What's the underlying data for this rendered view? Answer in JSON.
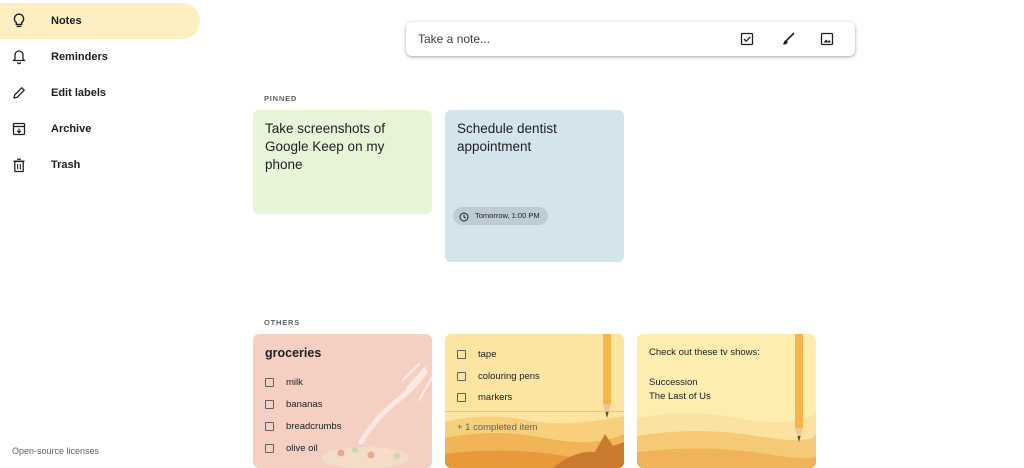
{
  "sidebar": {
    "items": [
      {
        "label": "Notes",
        "icon": "lightbulb-icon",
        "active": true
      },
      {
        "label": "Reminders",
        "icon": "bell-icon",
        "active": false
      },
      {
        "label": "Edit labels",
        "icon": "pencil-icon",
        "active": false
      },
      {
        "label": "Archive",
        "icon": "archive-icon",
        "active": false
      },
      {
        "label": "Trash",
        "icon": "trash-icon",
        "active": false
      }
    ],
    "footer_link": "Open-source licenses"
  },
  "take_note": {
    "placeholder": "Take a note...",
    "actions": [
      "checkbox-icon",
      "brush-icon",
      "image-icon"
    ]
  },
  "pinned": {
    "label": "PINNED",
    "notes": [
      {
        "title": "Take screenshots of Google Keep on my phone",
        "color": "#e6f4d7"
      },
      {
        "title": "Schedule dentist appointment",
        "color": "#d4e4ed",
        "reminder": "Tomorrow, 1:00 PM"
      }
    ]
  },
  "others": {
    "label": "OTHERS",
    "notes": [
      {
        "title": "groceries",
        "color": "#f6cfc3",
        "items": [
          "milk",
          "bananas",
          "breadcrumbs",
          "olive oil"
        ]
      },
      {
        "color": "#fde4a0",
        "items": [
          "tape",
          "colouring pens",
          "markers"
        ],
        "completed": "+ 1 completed item"
      },
      {
        "color": "#fdeeb0",
        "lines": [
          "Check out these tv shows:",
          "Succession",
          "The Last of Us"
        ]
      }
    ]
  },
  "colors": {
    "active_nav": "#feefc3",
    "text_primary": "#202124",
    "text_secondary": "#5f6368"
  }
}
